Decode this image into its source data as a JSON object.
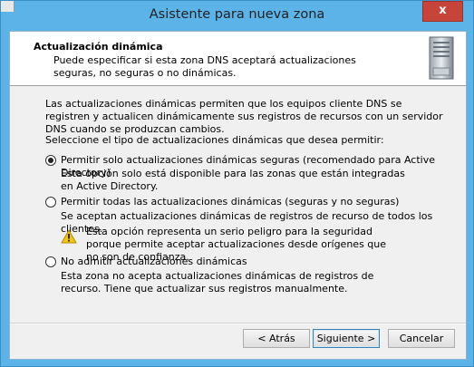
{
  "window": {
    "title": "Asistente para nueva zona",
    "close_glyph": "x"
  },
  "header": {
    "title": "Actualización dinámica",
    "description": "Puede especificar si esta zona DNS aceptará actualizaciones seguras, no seguras o no dinámicas.",
    "icon": "server-icon"
  },
  "body": {
    "intro": "Las actualizaciones dinámicas permiten que los equipos cliente DNS se registren y actualicen dinámicamente sus registros de recursos con un servidor DNS cuando se produzcan cambios.",
    "prompt": "Seleccione el tipo de actualizaciones dinámicas que desea permitir:",
    "options": [
      {
        "label": "Permitir solo actualizaciones dinámicas seguras (recomendado para Active Directory)",
        "description": "Esta opción solo está disponible para las zonas que están integradas en Active Directory.",
        "selected": true
      },
      {
        "label": "Permitir todas las actualizaciones dinámicas (seguras y no seguras)",
        "description": "Se aceptan actualizaciones dinámicas de registros de recurso de todos los clientes.",
        "warning": "Esta opción representa un serio peligro para la seguridad porque permite aceptar actualizaciones desde orígenes que no son de confianza.",
        "selected": false
      },
      {
        "label": "No admitir actualizaciones dinámicas",
        "description": "Esta zona no acepta actualizaciones dinámicas de registros de recurso. Tiene que actualizar sus registros manualmente.",
        "selected": false
      }
    ]
  },
  "buttons": {
    "back": "< Atrás",
    "next": "Siguiente >",
    "cancel": "Cancelar"
  }
}
